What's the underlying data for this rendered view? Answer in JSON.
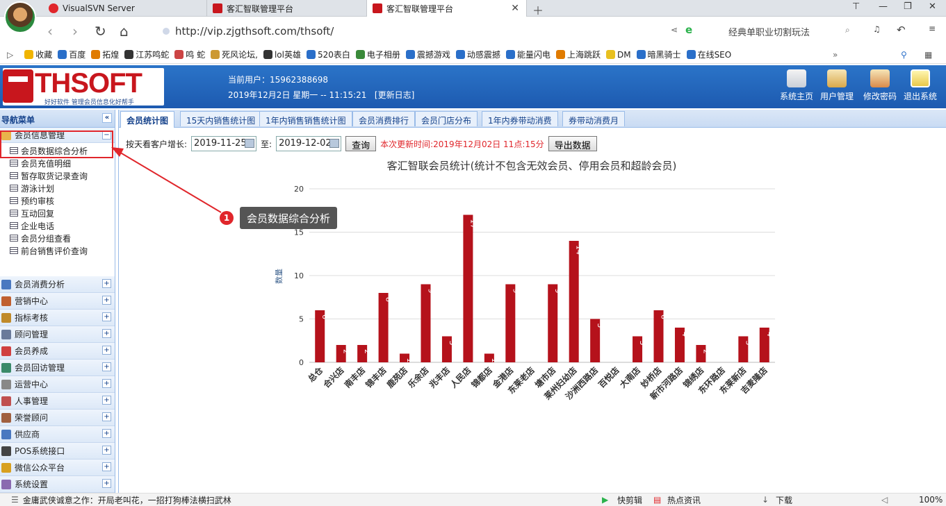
{
  "browser": {
    "tabs": [
      {
        "label": "VisualSVN Server"
      },
      {
        "label": "客汇智联管理平台"
      },
      {
        "label": "客汇智联管理平台"
      }
    ],
    "url": "http://vip.zjgthsoft.com/thsoft/",
    "search_hint": "经典单职业切割玩法",
    "bookmarks": [
      "收藏",
      "百度",
      "拓煌",
      "江苏鸣蛇",
      "鸣 蛇",
      "死风论坛,",
      "lol英雄",
      "520表白",
      "电子相册",
      "震撼游戏",
      "动感震撼",
      "能量闪电",
      "上海跳跃",
      "DM",
      "暗黑骑士",
      "在线SEO"
    ]
  },
  "app": {
    "logo": "THSOFT",
    "logo_tag": "好好软件  管理会员信息化好帮手",
    "current_user_label": "当前用户：15962388698",
    "datetime": "2019年12月2日 星期一 -- 11:15:21",
    "changelog": "[更新日志]",
    "top_buttons": [
      "系统主页",
      "用户管理",
      "修改密码",
      "退出系统"
    ]
  },
  "sidebar": {
    "title": "导航菜单",
    "expanded_group": "会员信息管理",
    "expanded_items": [
      "会员数据综合分析",
      "会员充值明细",
      "暂存取货记录查询",
      "游泳计划",
      "预约审核",
      "互动回复",
      "企业电话",
      "会员分组查看",
      "前台销售评价查询"
    ],
    "groups": [
      "会员消费分析",
      "营销中心",
      "指标考核",
      "顾问管理",
      "会员养成",
      "会员回访管理",
      "运营中心",
      "人事管理",
      "荣誉顾问",
      "供应商",
      "POS系统接口",
      "微信公众平台",
      "系统设置"
    ]
  },
  "content": {
    "tabs": [
      "会员统计图",
      "15天内销售统计图",
      "1年内销售销售统计图",
      "会员消费排行",
      "会员门店分布",
      "1年内券带动消费",
      "券带动消费月"
    ],
    "filter_label": "按天看客户增长:",
    "date_from": "2019-11-25",
    "to_label": "至:",
    "date_to": "2019-12-02",
    "query_button": "查询",
    "update_time": "本次更新时间:2019年12月02日  11点:15分",
    "export_button": "导出数据"
  },
  "callout": {
    "number": "1",
    "text": "会员数据综合分析"
  },
  "status": {
    "news": "金庸武侠诚意之作：开局老叫花，一招打狗棒法横扫武林",
    "items": [
      "快剪辑",
      "热点资讯",
      "下载"
    ],
    "zoom": "100%"
  },
  "chart_data": {
    "type": "bar",
    "title": "客汇智联会员统计(统计不包含无效会员、停用会员和超龄会员)",
    "ylabel": "数量",
    "ylim": [
      0,
      20
    ],
    "yticks": [
      0,
      5,
      10,
      15,
      20
    ],
    "categories": [
      "总仓",
      "合兴店",
      "南丰店",
      "锦丰店",
      "鹿苑店",
      "乐余店",
      "兆丰店",
      "人民店",
      "锦都店",
      "金港店",
      "东莱老店",
      "塘市店",
      "莱州妇幼店",
      "沙洲西路店",
      "百悦店",
      "大南店",
      "妙桥店",
      "新市河路店",
      "锦绣店",
      "东环路店",
      "东莱新店",
      "吉麦隆店"
    ],
    "values": [
      6,
      2,
      2,
      8,
      1,
      9,
      3,
      17,
      1,
      9,
      0,
      9,
      14,
      5,
      0,
      3,
      6,
      4,
      2,
      0,
      3,
      4
    ],
    "bar_color": "#b5121b",
    "grid": true
  }
}
